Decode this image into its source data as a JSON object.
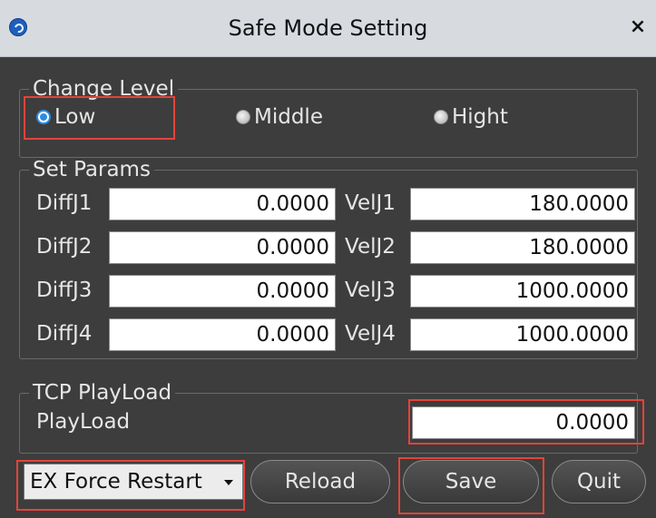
{
  "window": {
    "title": "Safe Mode Setting",
    "close_glyph": "×"
  },
  "change_level": {
    "legend": "Change Level",
    "options": [
      {
        "label": "Low",
        "selected": true
      },
      {
        "label": "Middle",
        "selected": false
      },
      {
        "label": "Hight",
        "selected": false
      }
    ]
  },
  "set_params": {
    "legend": "Set Params",
    "rows": [
      {
        "diff_label": "DiffJ1",
        "diff_value": "0.0000",
        "vel_label": "VelJ1",
        "vel_value": "180.0000"
      },
      {
        "diff_label": "DiffJ2",
        "diff_value": "0.0000",
        "vel_label": "VelJ2",
        "vel_value": "180.0000"
      },
      {
        "diff_label": "DiffJ3",
        "diff_value": "0.0000",
        "vel_label": "VelJ3",
        "vel_value": "1000.0000"
      },
      {
        "diff_label": "DiffJ4",
        "diff_value": "0.0000",
        "vel_label": "VelJ4",
        "vel_value": "1000.0000"
      }
    ]
  },
  "tcp_payload": {
    "legend": "TCP PlayLoad",
    "label": "PlayLoad",
    "value": "0.0000"
  },
  "footer": {
    "restart_select": "EX Force Restart",
    "reload_label": "Reload",
    "save_label": "Save",
    "quit_label": "Quit"
  },
  "colors": {
    "highlight": "#e3443a",
    "radio_selected": "#2d8de0",
    "panel_bg": "#3d3d3d"
  }
}
